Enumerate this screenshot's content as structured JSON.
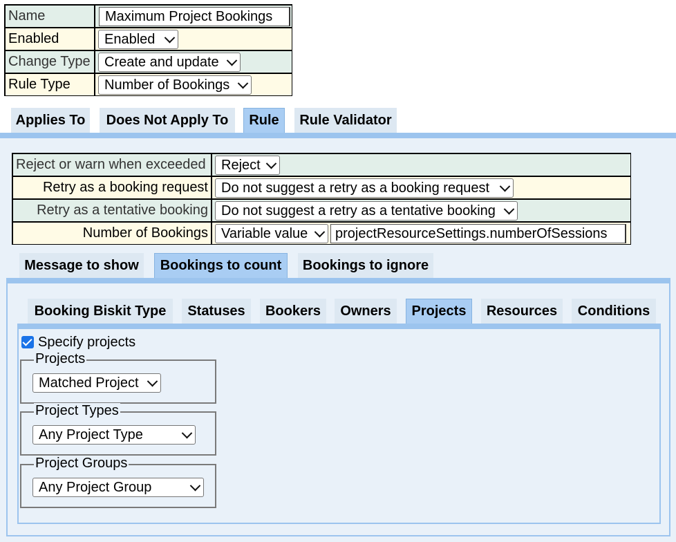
{
  "header_table": {
    "name_label": "Name",
    "name_value": "Maximum Project Bookings",
    "enabled_label": "Enabled",
    "enabled_value": "Enabled",
    "change_type_label": "Change Type",
    "change_type_value": "Create and update",
    "rule_type_label": "Rule Type",
    "rule_type_value": "Number of Bookings"
  },
  "main_tabs": [
    "Applies To",
    "Does Not Apply To",
    "Rule",
    "Rule Validator"
  ],
  "main_tabs_active": "Rule",
  "rule_table": {
    "reject_label": "Reject or warn when exceeded",
    "reject_value": "Reject",
    "retry_request_label": "Retry as a booking request",
    "retry_request_value": "Do not suggest a retry as a booking request",
    "retry_tentative_label": "Retry as a tentative booking",
    "retry_tentative_value": "Do not suggest a retry as a tentative booking",
    "num_bookings_label": "Number of Bookings",
    "num_bookings_mode": "Variable value",
    "num_bookings_expr": "projectResourceSettings.numberOfSessions"
  },
  "rule_tabs": [
    "Message to show",
    "Bookings to count",
    "Bookings to ignore"
  ],
  "rule_tabs_active": "Bookings to count",
  "count_tabs": [
    "Booking Biskit Type",
    "Statuses",
    "Bookers",
    "Owners",
    "Projects",
    "Resources",
    "Conditions"
  ],
  "count_tabs_active": "Projects",
  "projects_panel": {
    "specify_label": "Specify projects",
    "specify_checked": true,
    "projects_legend": "Projects",
    "projects_value": "Matched Project",
    "project_types_legend": "Project Types",
    "project_types_value": "Any Project Type",
    "project_groups_legend": "Project Groups",
    "project_groups_value": "Any Project Group"
  },
  "colors": {
    "tab_active": "#a9cdf3",
    "tab_inactive": "#dde8f2",
    "panel_bg": "#e9f1f9",
    "blue_border": "#9cc4ee",
    "row_green": "#e2efe9",
    "row_cream": "#fffbe6"
  }
}
